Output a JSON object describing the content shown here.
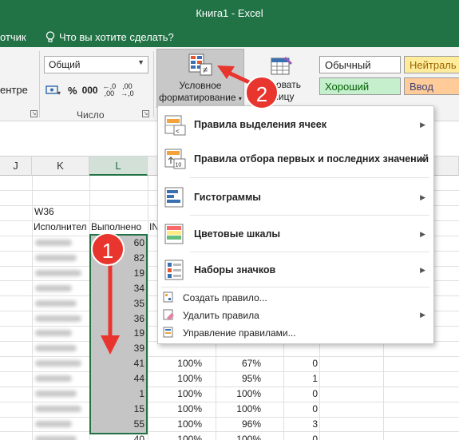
{
  "window": {
    "title": "Книга1  -  Excel"
  },
  "menubar": {
    "partial_tab": "отчик",
    "tell_me": "Что вы хотите сделать?"
  },
  "ribbon": {
    "left_partial": "ентре",
    "number_format": "Общий",
    "percent": "%",
    "comma": "000",
    "dec_inc": "←,0\n,00",
    "dec_dec": ",00\n→,0",
    "number_group_label": "Число",
    "cond_format_label_1": "Условное",
    "cond_format_label_2": "форматирование",
    "format_table_label_1": "тировать",
    "format_table_label_2": "блицу",
    "styles": [
      {
        "label": "Обычный",
        "bg": "#ffffff"
      },
      {
        "label": "Нейтраль",
        "bg": "#ffeb9c"
      },
      {
        "label": "Хороший",
        "bg": "#c6efce"
      },
      {
        "label": "Ввод",
        "bg": "#ffcc99"
      }
    ]
  },
  "sheet": {
    "columns": [
      {
        "label": "J"
      },
      {
        "label": "K"
      },
      {
        "label": "L"
      }
    ],
    "w36": "W36",
    "header_k": "Исполнител",
    "header_l": "Выполнено",
    "header_m": "IN",
    "values_l": [
      "60",
      "82",
      "19",
      "34",
      "35",
      "36",
      "19",
      "39",
      "41",
      "44",
      "1",
      "15",
      "55",
      "40"
    ],
    "values_m": [
      "",
      "",
      "",
      "",
      "",
      "",
      "",
      "",
      "100%",
      "100%",
      "100%",
      "100%",
      "100%",
      "100%"
    ],
    "values_n": [
      "",
      "",
      "",
      "",
      "",
      "",
      "",
      "",
      "67%",
      "95%",
      "100%",
      "100%",
      "96%",
      "100%"
    ],
    "values_o": [
      "",
      "",
      "",
      "",
      "",
      "",
      "",
      "",
      "0",
      "1",
      "0",
      "0",
      "3",
      "0"
    ]
  },
  "menu": {
    "items": [
      {
        "label": "Правила выделения ячеек",
        "has_arrow": true
      },
      {
        "label": "Правила отбора первых и последних значений",
        "has_arrow": true
      },
      {
        "label": "Гистограммы",
        "has_arrow": true
      },
      {
        "label": "Цветовые шкалы",
        "has_arrow": true
      },
      {
        "label": "Наборы значков",
        "has_arrow": true
      }
    ],
    "small_items": [
      {
        "label": "Создать правило...",
        "has_arrow": false
      },
      {
        "label": "Удалить правила",
        "has_arrow": true
      },
      {
        "label": "Управление правилами...",
        "has_arrow": false
      }
    ],
    "icon_10": "10"
  },
  "annotations": {
    "badge_1": "1",
    "badge_2": "2",
    "color": "#e8352e"
  }
}
